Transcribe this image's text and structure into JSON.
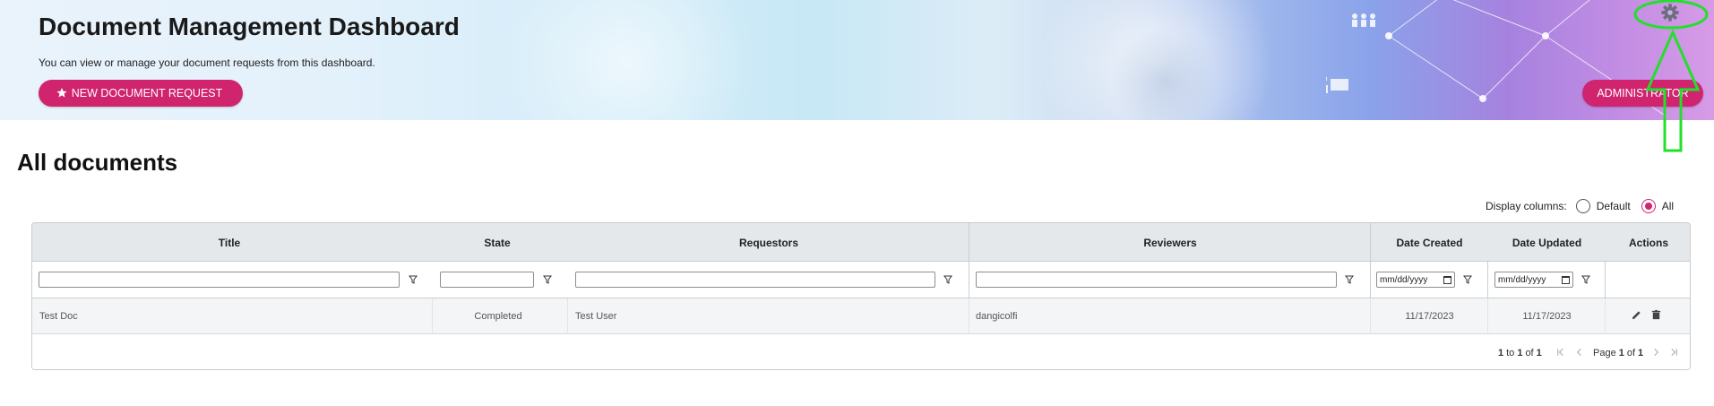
{
  "header": {
    "title": "Document Management Dashboard",
    "subtitle": "You can view or manage your document requests from this dashboard.",
    "new_request_label": "NEW DOCUMENT REQUEST",
    "new_request_icon": "star-icon",
    "admin_label": "ADMINISTRATOR",
    "settings_icon": "gear-icon"
  },
  "section": {
    "title": "All documents"
  },
  "display_columns": {
    "label": "Display columns:",
    "options": [
      {
        "label": "Default",
        "selected": false
      },
      {
        "label": "All",
        "selected": true
      }
    ]
  },
  "grid": {
    "columns": [
      "Title",
      "State",
      "Requestors",
      "Reviewers",
      "Date Created",
      "Date Updated",
      "Actions"
    ],
    "filters": {
      "date_created_placeholder": "mm/dd/yyyy",
      "date_updated_placeholder": "mm/dd/yyyy"
    },
    "rows": [
      {
        "title": "Test Doc",
        "state": "Completed",
        "requestors": "Test User",
        "reviewers": "dangicolfi",
        "date_created": "11/17/2023",
        "date_updated": "11/17/2023"
      }
    ],
    "pagination": {
      "range_from": "1",
      "range_to_word": "to",
      "range_to": "1",
      "of_word": "of",
      "total": "1",
      "page_word": "Page",
      "current_page": "1",
      "page_of_word": "of",
      "page_count": "1"
    }
  },
  "colors": {
    "accent": "#d0246f",
    "header_bg": "#e4e8ea",
    "annotation": "#22e02a"
  }
}
